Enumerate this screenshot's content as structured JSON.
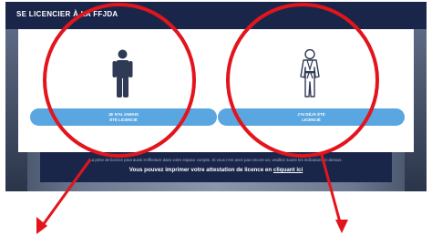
{
  "header": {
    "title": "SE LICENCIER À LA FFJDA"
  },
  "options": {
    "never_licensed": {
      "line1": "JE N'AI JAMAIS",
      "line2": "ÉTÉ LICENCIÉ",
      "icon": "person-standing-icon"
    },
    "already_licensed": {
      "line1": "J'AI DÉJÀ ÉTÉ",
      "line2": "LICENCIÉ",
      "icon": "judoka-gi-icon"
    }
  },
  "notice": {
    "small_text": "La prise de licence peut aussi s'effectuer dans votre espace compte. Si vous n'en avez pas encore un, veuillez suivre les indications ci-dessus.",
    "main_text": "Vous pouvez imprimer votre attestation de licence en",
    "link_text": "cliquant ici"
  },
  "annotations": {
    "color": "#e3151c",
    "shapes": [
      "red-circle-left",
      "red-circle-right",
      "red-arrow-left",
      "red-arrow-right"
    ]
  },
  "colors": {
    "header_bg": "#19264a",
    "button_bg": "#59a6e0",
    "icon_color": "#2f3a55"
  }
}
